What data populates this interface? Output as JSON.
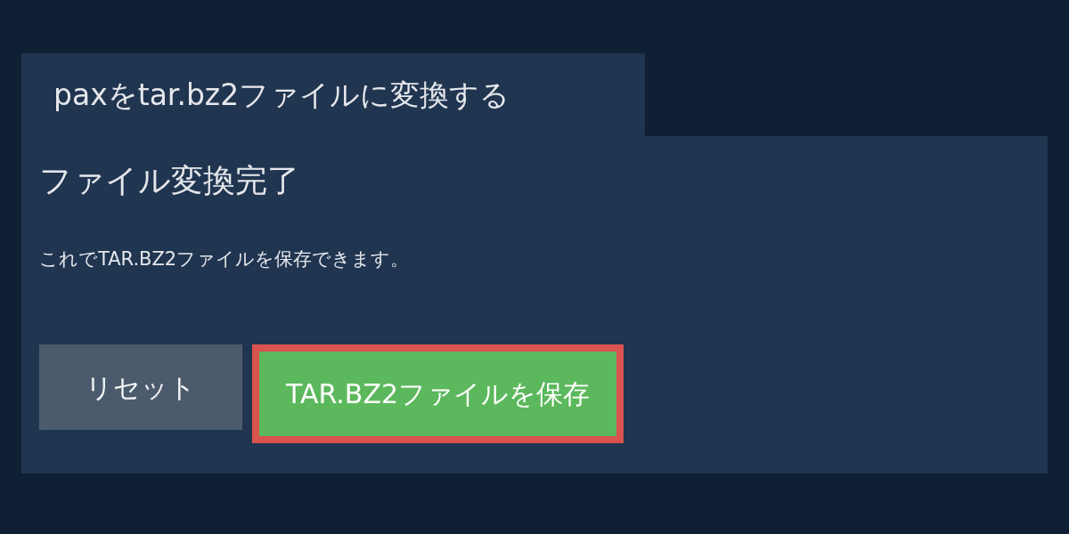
{
  "tab": {
    "title": "paxをtar.bz2ファイルに変換する"
  },
  "panel": {
    "heading": "ファイル変換完了",
    "message": "これでTAR.BZ2ファイルを保存できます。"
  },
  "buttons": [
    {
      "kind": "reset",
      "label": "リセット"
    },
    {
      "kind": "save",
      "label": "TAR.BZ2ファイルを保存"
    }
  ]
}
